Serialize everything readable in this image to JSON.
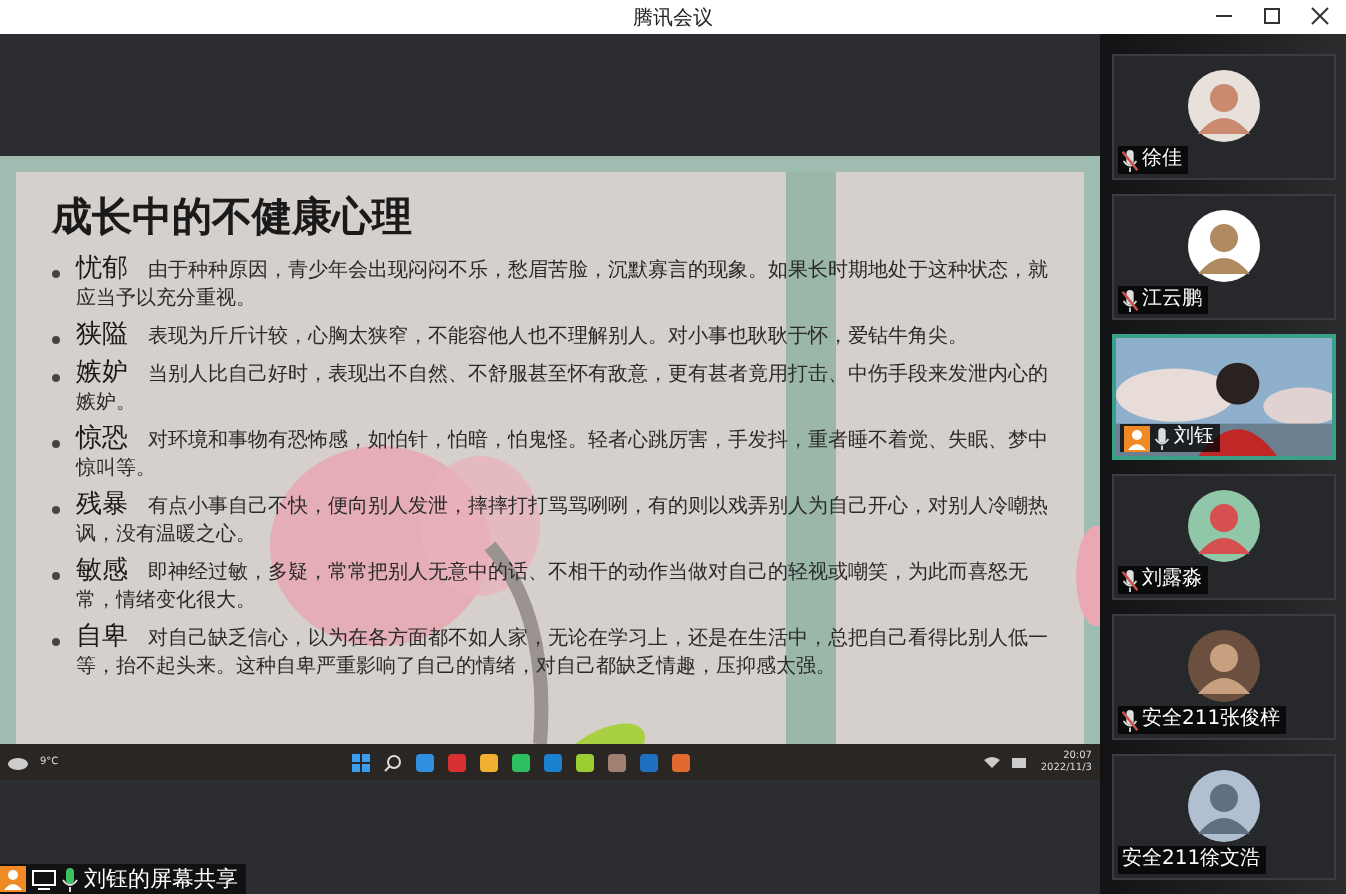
{
  "window": {
    "title": "腾讯会议"
  },
  "shared_screen": {
    "slide": {
      "title": "成长中的不健康心理",
      "items": [
        {
          "term": "忧郁",
          "text": "由于种种原因，青少年会出现闷闷不乐，愁眉苦脸，沉默寡言的现象。如果长时期地处于这种状态，就应当予以充分重视。"
        },
        {
          "term": "狭隘",
          "text": "表现为斤斤计较，心胸太狭窄，不能容他人也不理解别人。对小事也耿耿于怀，爱钻牛角尖。"
        },
        {
          "term": "嫉妒",
          "text": "当别人比自己好时，表现出不自然、不舒服甚至怀有敌意，更有甚者竟用打击、中伤手段来发泄内心的嫉妒。"
        },
        {
          "term": "惊恐",
          "text": "对环境和事物有恐怖感，如怕针，怕暗，怕鬼怪。轻者心跳厉害，手发抖，重者睡不着觉、失眠、梦中惊叫等。"
        },
        {
          "term": "残暴",
          "text": "有点小事自己不快，便向别人发泄，摔摔打打骂骂咧咧，有的则以戏弄别人为自己开心，对别人冷嘲热讽，没有温暖之心。"
        },
        {
          "term": "敏感",
          "text": "即神经过敏，多疑，常常把别人无意中的话、不相干的动作当做对自己的轻视或嘲笑，为此而喜怒无常，情绪变化很大。"
        },
        {
          "term": "自卑",
          "text": "对自己缺乏信心，以为在各方面都不如人家，无论在学习上，还是在生活中，总把自己看得比别人低一等，抬不起头来。这种自卑严重影响了自己的情绪，对自己都缺乏情趣，压抑感太强。"
        }
      ]
    },
    "taskbar": {
      "weather": "9°C",
      "time": "20:07",
      "date": "2022/11/3"
    }
  },
  "share_label": {
    "host": true,
    "muted": false,
    "text": "刘钰的屏幕共享"
  },
  "participants": [
    {
      "name": "徐佳",
      "kind": "avatar",
      "mic_icon": true,
      "muted": true,
      "host": false,
      "selected": false
    },
    {
      "name": "江云鹏",
      "kind": "avatar",
      "mic_icon": true,
      "muted": true,
      "host": false,
      "selected": false
    },
    {
      "name": "刘钰",
      "kind": "video",
      "mic_icon": true,
      "muted": false,
      "host": true,
      "selected": true
    },
    {
      "name": "刘露淼",
      "kind": "avatar",
      "mic_icon": true,
      "muted": true,
      "host": false,
      "selected": false
    },
    {
      "name": "安全211张俊梓",
      "kind": "avatar",
      "mic_icon": true,
      "muted": true,
      "host": false,
      "selected": false
    },
    {
      "name": "安全211徐文浩",
      "kind": "avatar",
      "mic_icon": false,
      "host": false,
      "selected": false
    }
  ]
}
